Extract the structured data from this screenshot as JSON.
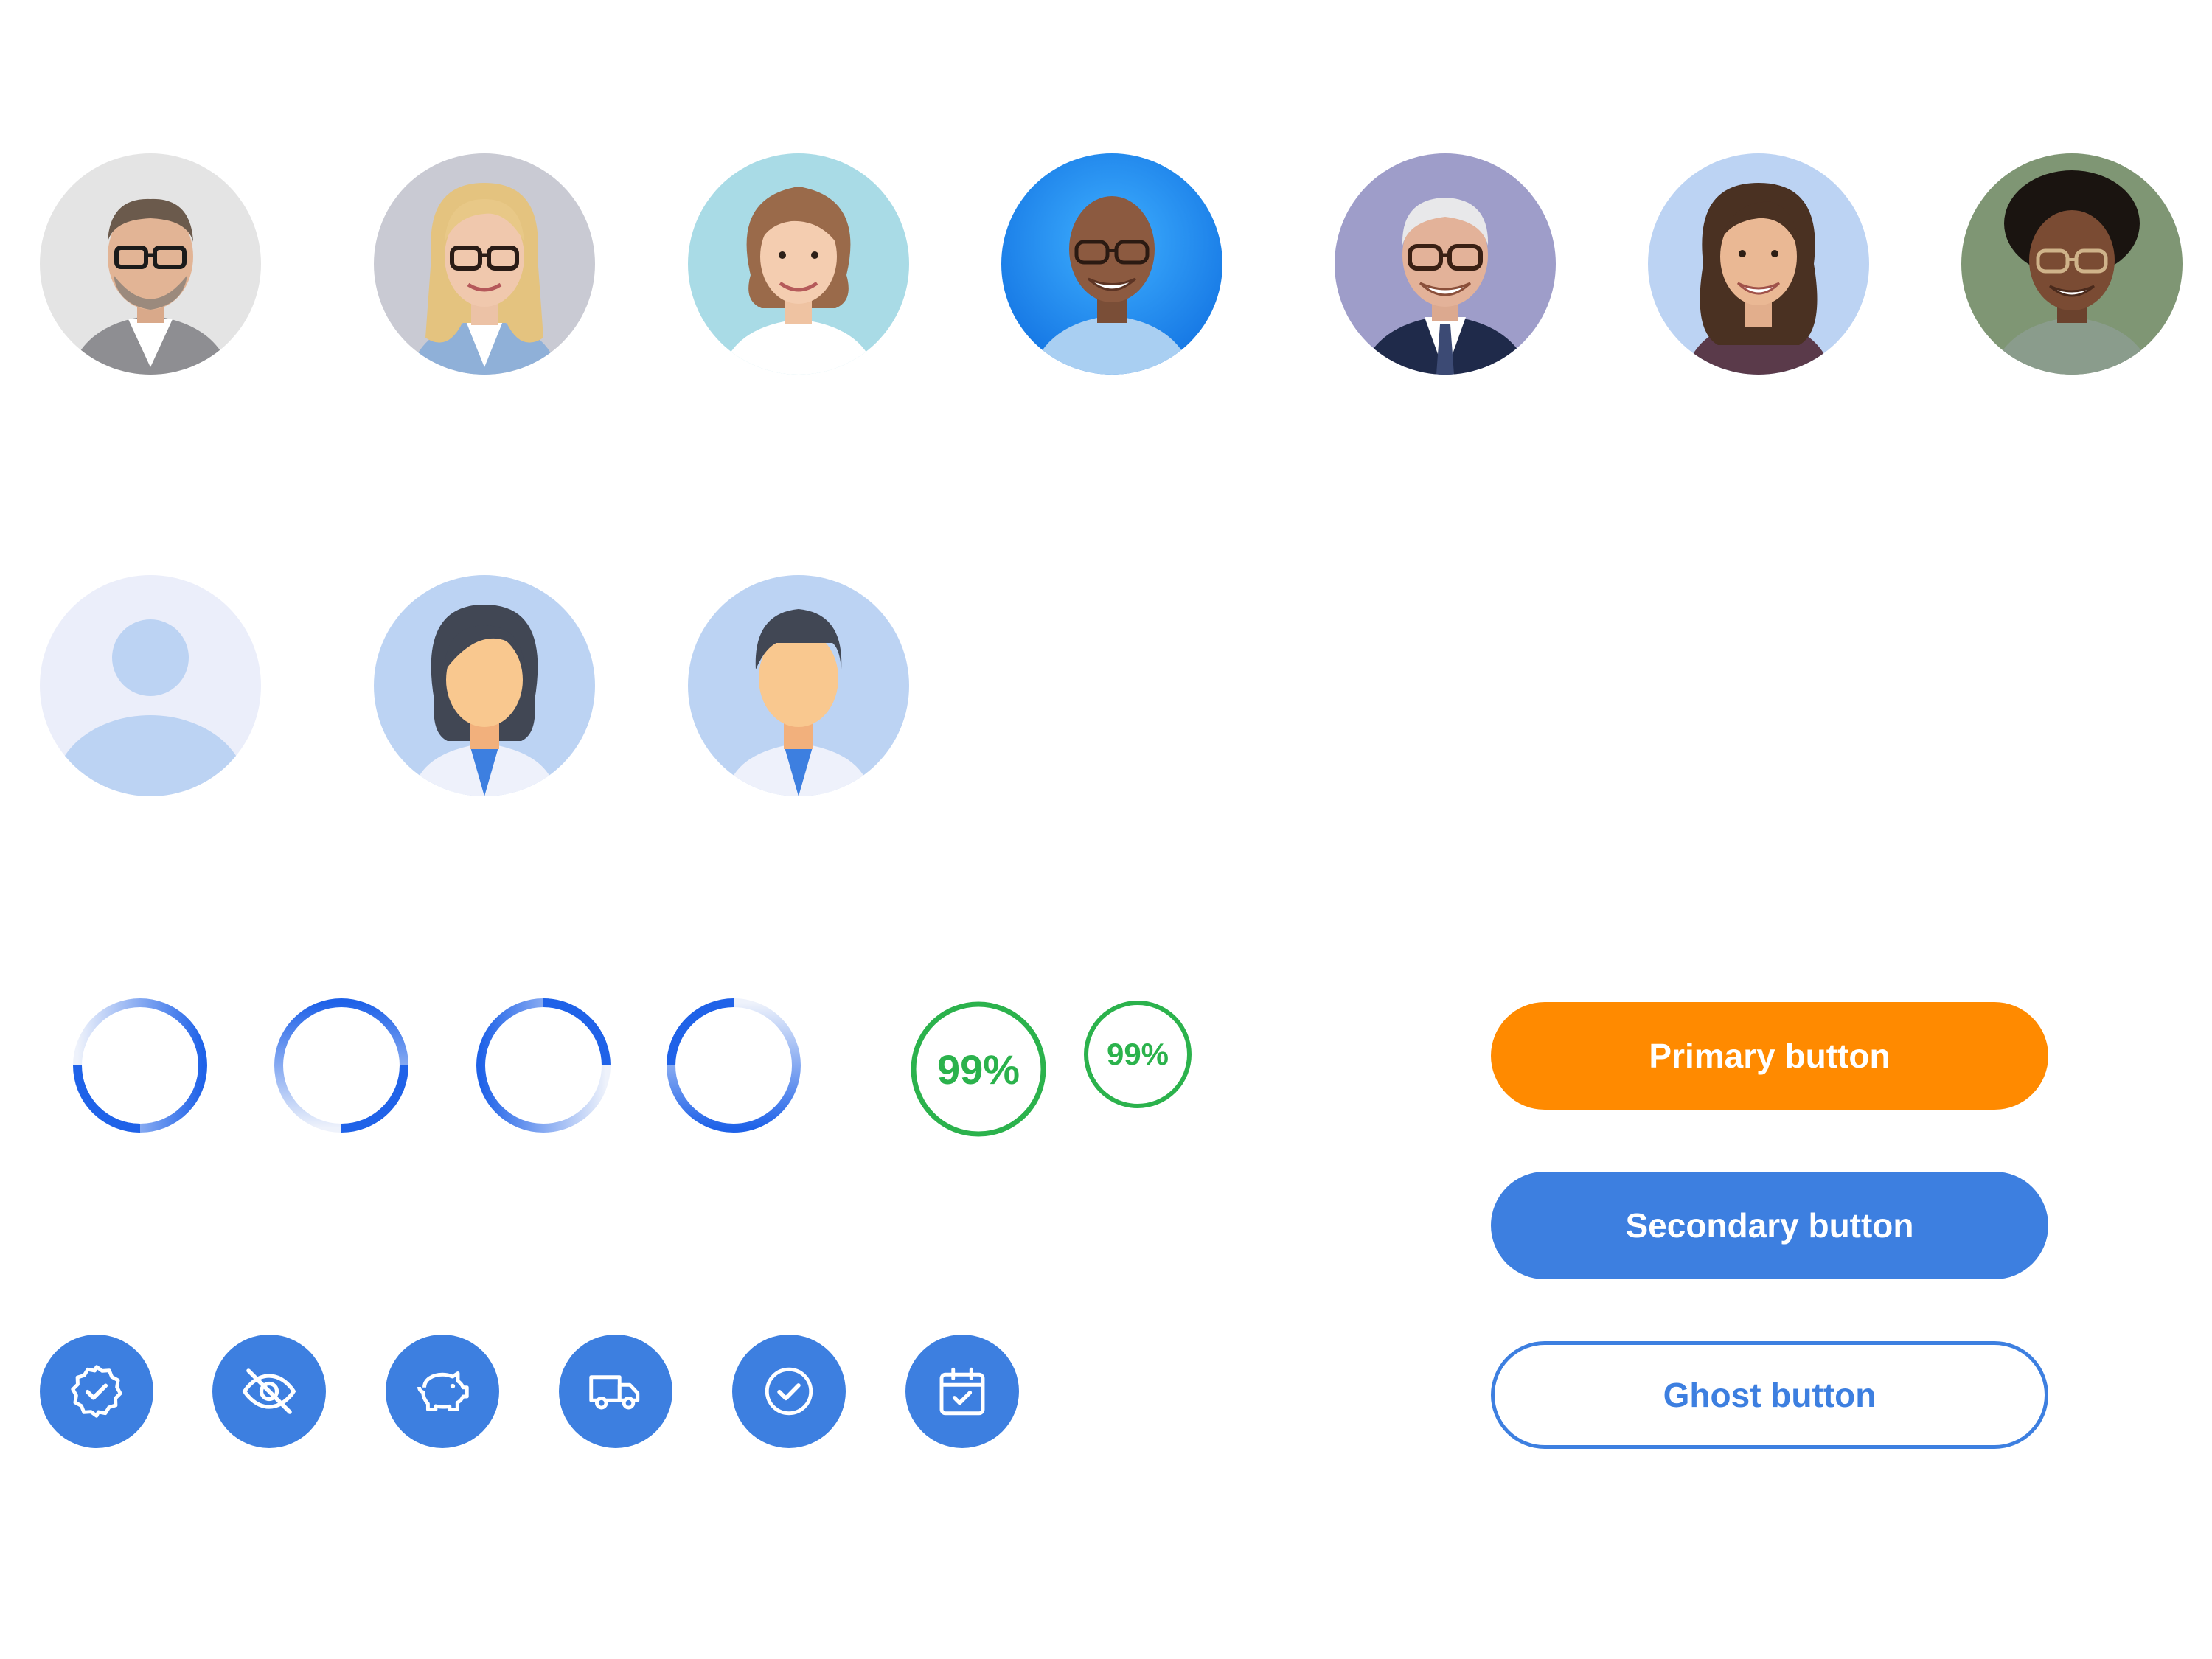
{
  "avatars": [
    {
      "name": "photo-avatar-man-glasses-gray-suit",
      "bg": "#e4e4e4"
    },
    {
      "name": "photo-avatar-blonde-woman-glasses",
      "bg": "#c9cad3"
    },
    {
      "name": "photo-avatar-woman-short-hair",
      "bg": "#a9dbe6"
    },
    {
      "name": "photo-avatar-bald-man-glasses",
      "bg": "#1f86ea"
    },
    {
      "name": "photo-avatar-older-man-suit",
      "bg": "#9e9dc9"
    },
    {
      "name": "photo-avatar-woman-curly-hair",
      "bg": "#bcd3f3"
    },
    {
      "name": "photo-avatar-woman-afro-glasses",
      "bg": "#7f9674"
    }
  ],
  "placeholders": [
    {
      "name": "default-user-avatar-icon"
    },
    {
      "name": "female-doctor-avatar-icon"
    },
    {
      "name": "male-doctor-avatar-icon"
    }
  ],
  "spinners": [
    {
      "name": "loading-spinner-1",
      "rotation": 180
    },
    {
      "name": "loading-spinner-2",
      "rotation": 90
    },
    {
      "name": "loading-spinner-3",
      "rotation": 0
    },
    {
      "name": "loading-spinner-4",
      "rotation": 270
    }
  ],
  "progress": {
    "large": {
      "label": "99%",
      "value": 99
    },
    "small": {
      "label": "99%",
      "value": 99
    },
    "color": "#2bb24c"
  },
  "icon_buttons": [
    {
      "name": "verified-badge-icon"
    },
    {
      "name": "eye-off-icon"
    },
    {
      "name": "piggy-bank-icon"
    },
    {
      "name": "delivery-truck-icon"
    },
    {
      "name": "check-circle-icon"
    },
    {
      "name": "calendar-check-icon"
    }
  ],
  "buttons": {
    "primary_label": "Primary button",
    "secondary_label": "Secondary button",
    "ghost_label": "Ghost button"
  },
  "colors": {
    "primary": "#ff8a00",
    "accent": "#3d7fe0",
    "success": "#2bb24c"
  }
}
